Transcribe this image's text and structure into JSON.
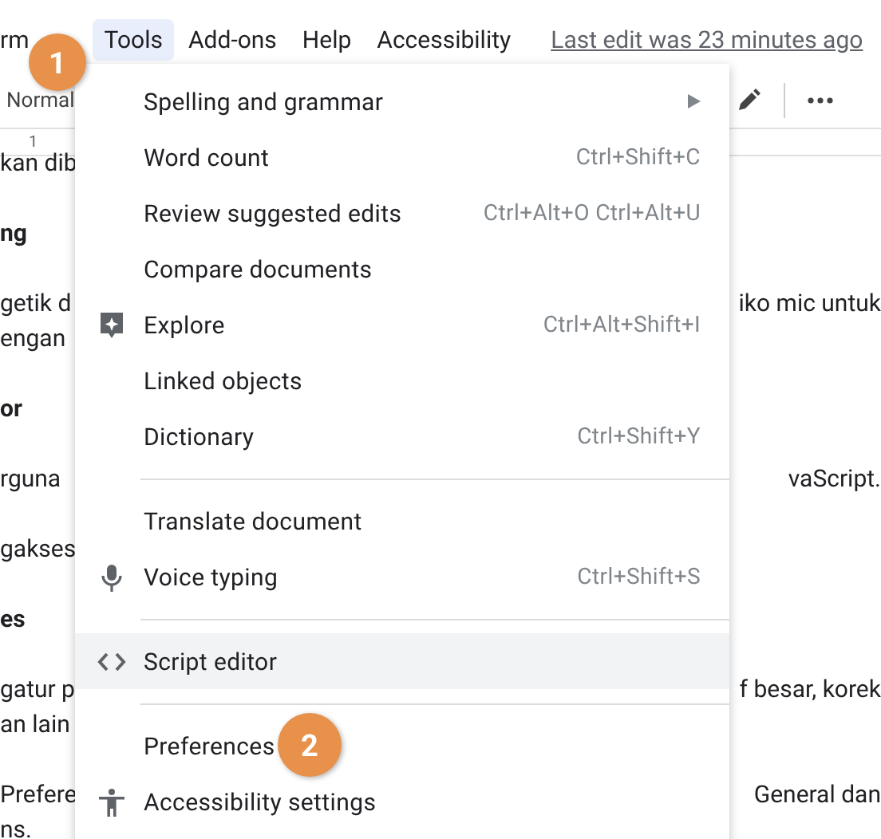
{
  "menu_bar": {
    "items": [
      {
        "label": "rm",
        "selected": false
      },
      {
        "label": "Tools",
        "selected": true
      },
      {
        "label": "Add-ons",
        "selected": false
      },
      {
        "label": "Help",
        "selected": false
      },
      {
        "label": "Accessibility",
        "selected": false
      }
    ],
    "last_edit": "Last edit was 23 minutes ago"
  },
  "toolbar": {
    "style": "Normal"
  },
  "ruler": {
    "mark": "1"
  },
  "document": {
    "paragraphs": [
      {
        "kind": "text",
        "lines": [
          {
            "left": "kan dib"
          }
        ]
      },
      {
        "kind": "heading",
        "lines": [
          {
            "left": "ng"
          }
        ]
      },
      {
        "kind": "text",
        "lines": [
          {
            "left": "getik d",
            "right": "iko mic untuk"
          },
          {
            "left": "engan"
          }
        ]
      },
      {
        "kind": "heading",
        "lines": [
          {
            "left": "or"
          }
        ]
      },
      {
        "kind": "text",
        "lines": [
          {
            "left": "rguna",
            "right": "vaScript."
          }
        ]
      },
      {
        "kind": "text",
        "lines": [
          {
            "left": "gakses"
          }
        ]
      },
      {
        "kind": "heading",
        "lines": [
          {
            "left": "es"
          }
        ]
      },
      {
        "kind": "text",
        "lines": [
          {
            "left": "gatur p",
            "right": "f besar, korek"
          },
          {
            "left": "an lain"
          }
        ]
      },
      {
        "kind": "text",
        "lines": [
          {
            "left": "Prefere",
            "right": "General dan"
          },
          {
            "left": "ns."
          }
        ]
      }
    ]
  },
  "menu": {
    "items": [
      {
        "kind": "item",
        "label": "Spelling and grammar",
        "submenu": true,
        "highlighted": false
      },
      {
        "kind": "item",
        "label": "Word count",
        "shortcut": "Ctrl+Shift+C",
        "highlighted": false
      },
      {
        "kind": "item",
        "label": "Review suggested edits",
        "shortcut": "Ctrl+Alt+O Ctrl+Alt+U",
        "highlighted": false
      },
      {
        "kind": "item",
        "label": "Compare documents",
        "highlighted": false
      },
      {
        "kind": "item",
        "label": "Explore",
        "shortcut": "Ctrl+Alt+Shift+I",
        "highlighted": false
      },
      {
        "kind": "item",
        "label": "Linked objects",
        "highlighted": false
      },
      {
        "kind": "item",
        "label": "Dictionary",
        "shortcut": "Ctrl+Shift+Y",
        "highlighted": false
      },
      {
        "kind": "separator"
      },
      {
        "kind": "item",
        "label": "Translate document",
        "highlighted": false
      },
      {
        "kind": "item",
        "label": "Voice typing",
        "shortcut": "Ctrl+Shift+S",
        "highlighted": false
      },
      {
        "kind": "separator"
      },
      {
        "kind": "item",
        "label": "Script editor",
        "highlighted": true
      },
      {
        "kind": "separator"
      },
      {
        "kind": "item",
        "label": "Preferences",
        "highlighted": false
      },
      {
        "kind": "item",
        "label": "Accessibility settings",
        "highlighted": false
      }
    ]
  },
  "annotations": [
    {
      "label": "1"
    },
    {
      "label": "2"
    }
  ]
}
